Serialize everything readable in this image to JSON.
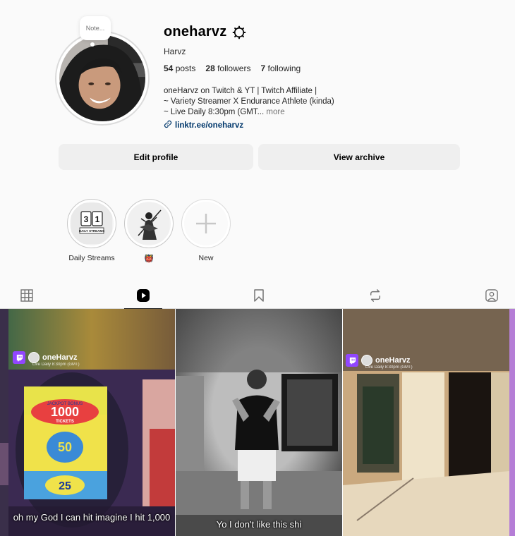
{
  "profile": {
    "note_placeholder": "Note...",
    "username": "oneharvz",
    "display_name": "Harvz",
    "posts_count": "54",
    "posts_label": "posts",
    "followers_count": "28",
    "followers_label": "followers",
    "following_count": "7",
    "following_label": "following",
    "bio_line1": "oneHarvz on Twitch & YT | Twitch Affiliate |",
    "bio_line2": "~ Variety Streamer X Endurance Athlete (kinda)",
    "bio_line3": "~ Live Daily 8:30pm (GMT...",
    "bio_more": "more",
    "link": "linktr.ee/oneharvz"
  },
  "actions": {
    "edit_profile": "Edit profile",
    "view_archive": "View archive"
  },
  "highlights": [
    {
      "label": "Daily Streams",
      "cover_text_1": "3",
      "cover_text_2": "1",
      "cover_caption": "DAILY STREAMS"
    },
    {
      "label": "👹",
      "icon": "samurai-image"
    },
    {
      "label": "New",
      "icon": "plus-icon"
    }
  ],
  "tabs": [
    {
      "name": "posts",
      "icon": "grid-icon"
    },
    {
      "name": "reels",
      "icon": "reels-icon"
    },
    {
      "name": "saved",
      "icon": "bookmark-icon"
    },
    {
      "name": "reposts",
      "icon": "repost-icon"
    },
    {
      "name": "tagged",
      "icon": "tagged-icon"
    }
  ],
  "reels": [
    {
      "overlay_name": "oneHarvz",
      "overlay_sub": "Live Daily 8:30pm (GMT)",
      "machine_top": "1000",
      "machine_mid": "50",
      "machine_bot": "25",
      "machine_word": "TICKETS",
      "machine_header": "JACKPOT BONUS",
      "caption": "oh my God I can hit imagine I hit 1,000"
    },
    {
      "caption": "Yo I don't like this shi"
    },
    {
      "overlay_name": "oneHarvz",
      "overlay_sub": "Live Daily 8:30pm (GMT)"
    }
  ],
  "colors": {
    "background": "#fafafa",
    "button": "#efefef",
    "link": "#00376b",
    "twitch": "#9146ff"
  }
}
